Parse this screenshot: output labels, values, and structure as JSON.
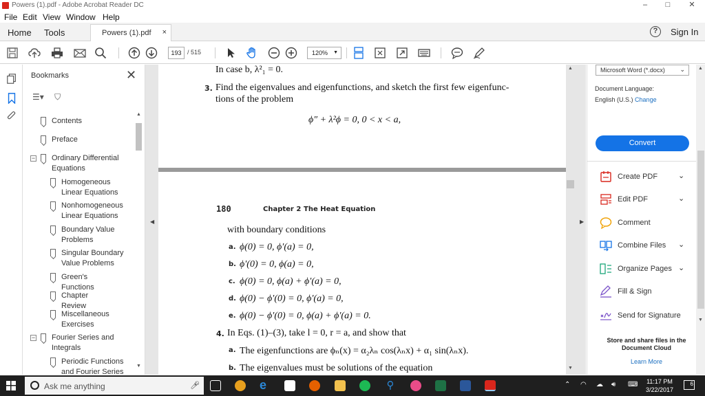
{
  "window": {
    "title": "Powers (1).pdf - Adobe Acrobat Reader DC",
    "minimize": "–",
    "maximize": "□",
    "close": "✕"
  },
  "menu": [
    "File",
    "Edit",
    "View",
    "Window",
    "Help"
  ],
  "tabs": {
    "home": "Home",
    "tools": "Tools",
    "document": "Powers (1).pdf",
    "close": "×",
    "help": "?",
    "sign_in": "Sign In"
  },
  "toolbar": {
    "page_current": "193",
    "page_total": "/ 515",
    "zoom": "120%"
  },
  "bookmarks": {
    "title": "Bookmarks",
    "close": "✕",
    "items": [
      "Contents",
      "Preface",
      "Ordinary Differential\nEquations",
      "Homogeneous\nLinear Equations",
      "Nonhomogeneous\nLinear Equations",
      "Boundary Value\nProblems",
      "Singular Boundary\nValue Problems",
      "Green's Functions",
      "Chapter Review",
      "Miscellaneous\nExercises",
      "Fourier Series and\nIntegrals",
      "Periodic Functions\nand Fourier Series"
    ]
  },
  "document": {
    "top_line": "In case b, λ²₁ = 0.",
    "problem3_num": "3.",
    "problem3_line1": "Find the eigenvalues and eigenfunctions, and sketch the first few eigenfunc-",
    "problem3_line2": "tions of the problem",
    "problem3_eq": "ϕ″ + λ²ϕ = 0,     0 < x < a,",
    "page_number": "180",
    "chapter": "Chapter 2",
    "chapter_title": "The Heat Equation",
    "boundary_intro": "with boundary conditions",
    "conditions": [
      {
        "label": "a.",
        "text": "ϕ(0) = 0,   ϕ′(a) = 0,"
      },
      {
        "label": "b.",
        "text": "ϕ′(0) = 0,   ϕ(a) = 0,"
      },
      {
        "label": "c.",
        "text": "ϕ(0) = 0,   ϕ(a) + ϕ′(a) = 0,"
      },
      {
        "label": "d.",
        "text": "ϕ(0) − ϕ′(0) = 0,   ϕ′(a) = 0,"
      },
      {
        "label": "e.",
        "text": "ϕ(0) − ϕ′(0) = 0,   ϕ(a) + ϕ′(a) = 0."
      }
    ],
    "problem4_num": "4.",
    "problem4_text": "In Eqs. (1)–(3), take l = 0, r = a, and show that",
    "p4a_label": "a.",
    "p4a_text": "The eigenfunctions are ϕₙ(x) = α₂λₙ cos(λₙx) + α₁ sin(λₙx).",
    "p4b_label": "b.",
    "p4b_text": "The eigenvalues must be solutions of the equation"
  },
  "right_pane": {
    "format": "Microsoft Word (*.docx)",
    "language_label": "Document Language:",
    "language_value": "English (U.S.)",
    "change": "Change",
    "convert": "Convert",
    "tools": [
      {
        "label": "Create PDF",
        "chevron": "⌄"
      },
      {
        "label": "Edit PDF",
        "chevron": "⌄"
      },
      {
        "label": "Comment",
        "chevron": ""
      },
      {
        "label": "Combine Files",
        "chevron": "⌄"
      },
      {
        "label": "Organize Pages",
        "chevron": "⌄"
      },
      {
        "label": "Fill & Sign",
        "chevron": ""
      },
      {
        "label": "Send for Signature",
        "chevron": ""
      }
    ],
    "store_title": "Store and share files in the Document Cloud",
    "learn_more": "Learn More"
  },
  "taskbar": {
    "search_placeholder": "Ask me anything",
    "time": "11:17 PM",
    "date": "3/22/2017",
    "notifications": "6"
  },
  "colors": {
    "accent": "#1473e6",
    "acrobat_red": "#d9261c",
    "taskbar": "#1f1f1f"
  }
}
